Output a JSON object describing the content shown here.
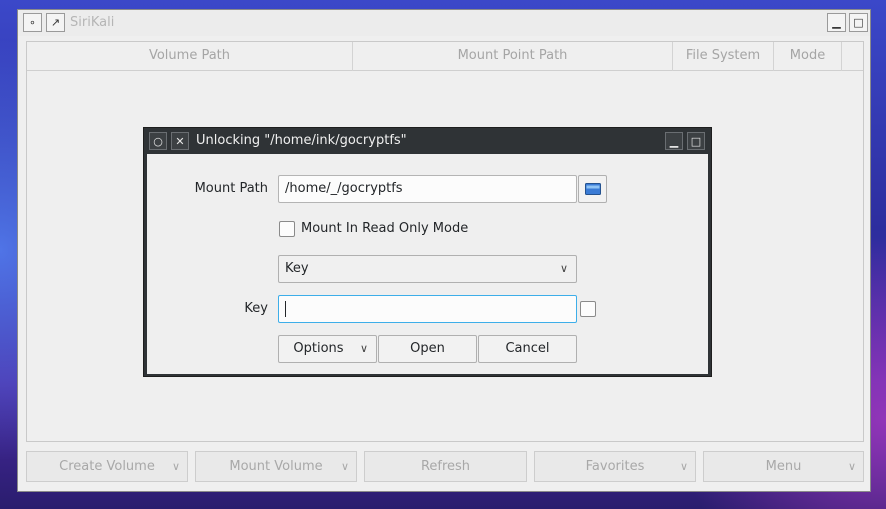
{
  "main_window": {
    "title": "SiriKali",
    "table_headers": [
      "Volume Path",
      "Mount Point Path",
      "File System",
      "Mode"
    ],
    "bottom_buttons": [
      "Create Volume",
      "Mount Volume",
      "Refresh",
      "Favorites",
      "Menu"
    ]
  },
  "dialog": {
    "title": "Unlocking \"/home/ink/gocryptfs\"",
    "mount_path_label": "Mount Path",
    "mount_path_value": "/home/_/gocryptfs",
    "read_only_label": "Mount In Read Only Mode",
    "key_type_selected": "Key",
    "key_label": "Key",
    "options_label": "Options",
    "open_label": "Open",
    "cancel_label": "Cancel"
  },
  "colors": {
    "focus_border": "#3daee9",
    "dialog_titlebar": "#2f3336",
    "window_bg": "#efefef"
  },
  "icons": [
    "pin-icon",
    "keep-above-icon",
    "minimize-icon",
    "maximize-icon",
    "close-icon",
    "folder-icon",
    "chevron-down-icon"
  ]
}
